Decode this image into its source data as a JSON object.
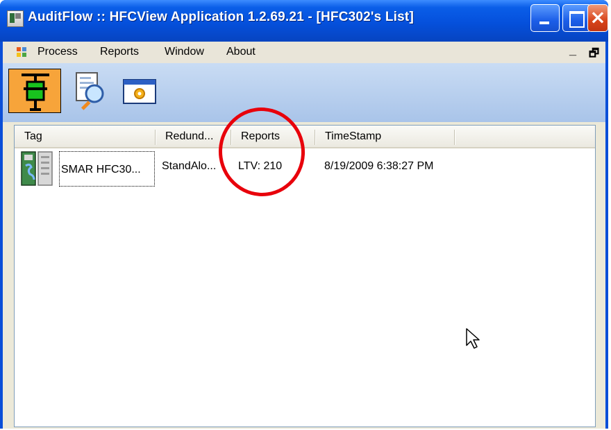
{
  "window": {
    "title": "AuditFlow :: HFCView Application 1.2.69.21 - [HFC302's List]"
  },
  "menubar": {
    "items": [
      {
        "label": "Process"
      },
      {
        "label": "Reports"
      },
      {
        "label": "Window"
      },
      {
        "label": "About"
      }
    ],
    "mdi_minimize": "_",
    "mdi_restore": "🗗"
  },
  "toolbar": {
    "buttons": [
      {
        "icon": "device-tag-icon",
        "active": true
      },
      {
        "icon": "report-search-icon",
        "active": false
      },
      {
        "icon": "settings-window-icon",
        "active": false
      }
    ]
  },
  "list": {
    "columns": [
      "Tag",
      "Redund...",
      "Reports",
      "TimeStamp"
    ],
    "rows": [
      {
        "tag": "SMAR HFC30...",
        "redundancy": "StandAlo...",
        "reports": "LTV: 210",
        "timestamp": "8/19/2009 6:38:27 PM"
      }
    ]
  },
  "colors": {
    "titlebar": "#0550dc",
    "highlight_circle": "#e8000b",
    "active_tool": "#f7a43a"
  }
}
